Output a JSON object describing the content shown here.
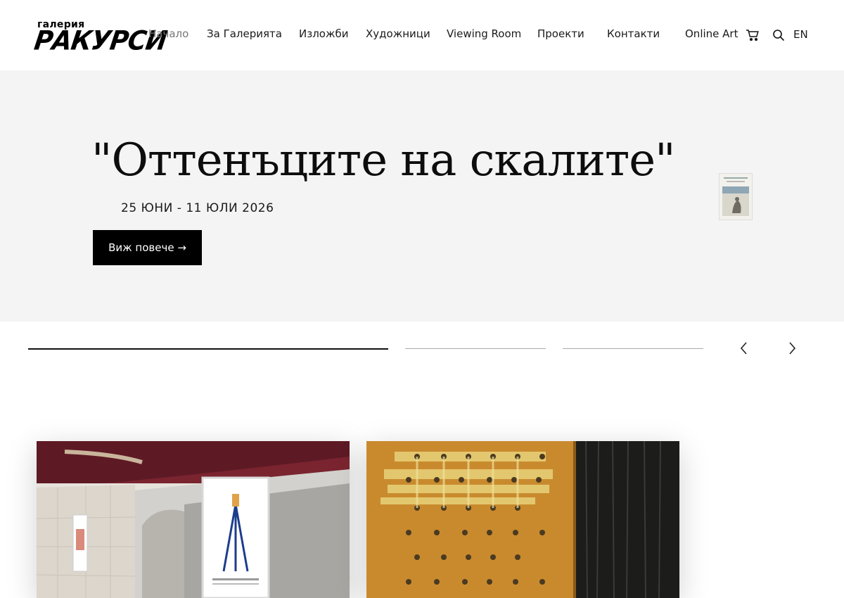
{
  "brand": {
    "small": "галерия",
    "big": "РАКУРСИ"
  },
  "nav": {
    "items": [
      {
        "label": "Начало",
        "active": true
      },
      {
        "label": "За Галерията"
      },
      {
        "label": "Изложби"
      },
      {
        "label": "Художници"
      },
      {
        "label": "Viewing Room"
      },
      {
        "label": "Проекти"
      },
      {
        "label": "Контакти"
      },
      {
        "label": "Online Art"
      }
    ],
    "cart_icon": "cart-icon",
    "search_icon": "search-icon",
    "language": "EN"
  },
  "hero": {
    "title": "\"Оттенъците на скалите\"",
    "date": "25 ЮНИ - 11 ЮЛИ 2026",
    "button_label": "Виж повече →",
    "slide_progress": [
      1,
      0,
      0
    ]
  },
  "colors": {
    "hero_bg": "#f4f4f4",
    "button_bg": "#000000",
    "nav_active": "#777777"
  },
  "slider": {
    "prev_icon": "chevron-left-icon",
    "next_icon": "chevron-right-icon"
  },
  "cards": [
    {
      "image": "gallery-interior-with-poster"
    },
    {
      "image": "abstract-orange-and-black-painting"
    }
  ]
}
